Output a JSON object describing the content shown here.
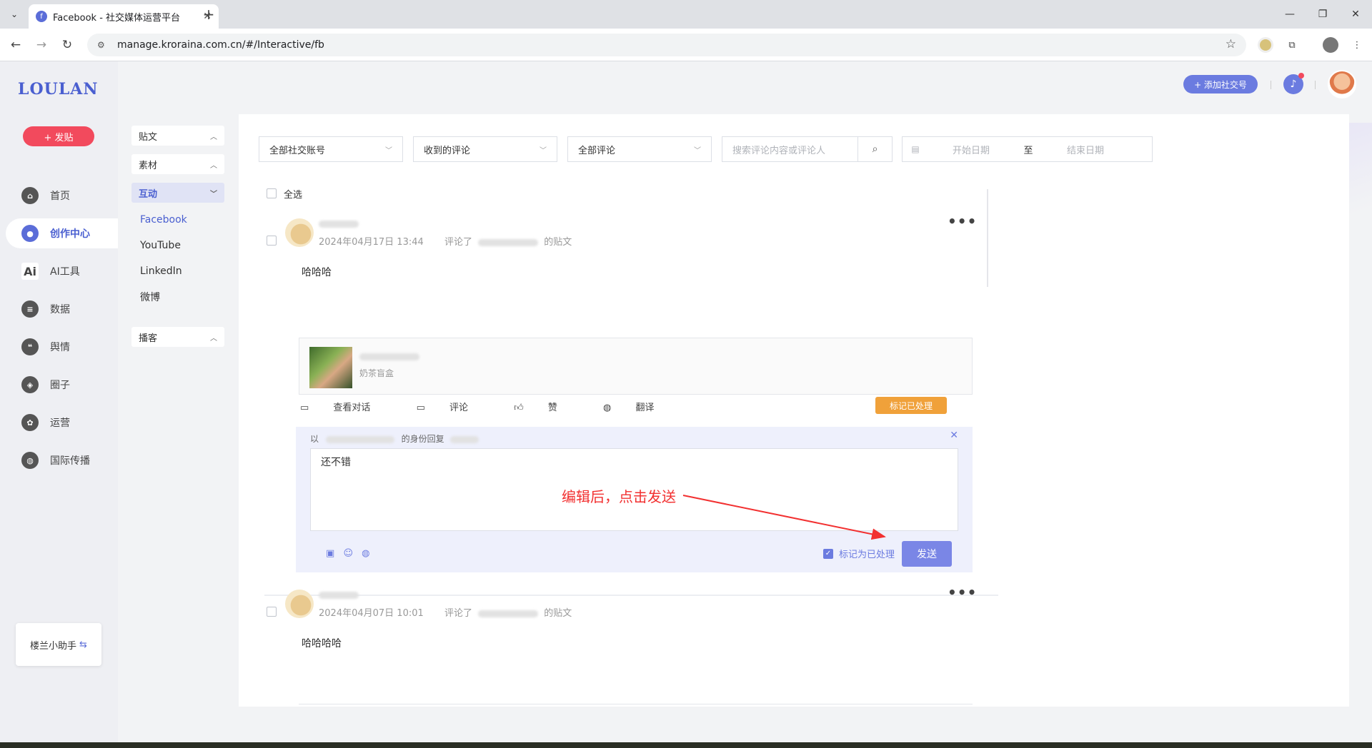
{
  "browser": {
    "tab_title": "Facebook - 社交媒体运营平台",
    "url": "manage.kroraina.com.cn/#/Interactive/fb"
  },
  "app": {
    "logo": "LOULAN",
    "post_button": "+ 发贴",
    "nav": [
      {
        "label": "首页",
        "icon": "home-icon"
      },
      {
        "label": "创作中心",
        "icon": "palette-icon"
      },
      {
        "label": "AI工具",
        "icon": "ai-icon"
      },
      {
        "label": "数据",
        "icon": "database-icon"
      },
      {
        "label": "舆情",
        "icon": "quote-icon"
      },
      {
        "label": "圈子",
        "icon": "compass-icon"
      },
      {
        "label": "运营",
        "icon": "operation-icon"
      },
      {
        "label": "国际传播",
        "icon": "globe-icon"
      }
    ],
    "assistant": "楼兰小助手",
    "add_social": "+ 添加社交号"
  },
  "subnav": {
    "groups": [
      "贴文",
      "素材",
      "互动",
      "播客"
    ],
    "items": [
      "Facebook",
      "YouTube",
      "LinkedIn",
      "微博"
    ]
  },
  "filters": {
    "account": "全部社交账号",
    "received": "收到的评论",
    "all_comments": "全部评论",
    "search_placeholder": "搜索评论内容或评论人",
    "start_date": "开始日期",
    "to": "至",
    "end_date": "结束日期",
    "select_all": "全选"
  },
  "comments": [
    {
      "time": "2024年04月17日 13:44",
      "commented_prefix": "评论了",
      "commented_suffix": "的贴文",
      "text": "哈哈哈",
      "post_subtitle": "奶茶盲盒",
      "actions": [
        "查看对话",
        "评论",
        "赞",
        "翻译"
      ],
      "mark_button": "标记已处理",
      "reply": {
        "prefix": "以",
        "middle": "的身份回复",
        "value": "还不错",
        "mark_label": "标记为已处理",
        "send": "发送"
      }
    },
    {
      "time": "2024年04月07日 10:01",
      "commented_prefix": "评论了",
      "commented_suffix": "的贴文",
      "text": "哈哈哈哈"
    }
  ],
  "annotation": "编辑后，点击发送",
  "colors": {
    "accent": "#5b6dd8",
    "danger": "#f24a5d",
    "warning": "#f0a13a",
    "annotation": "#f23030"
  }
}
